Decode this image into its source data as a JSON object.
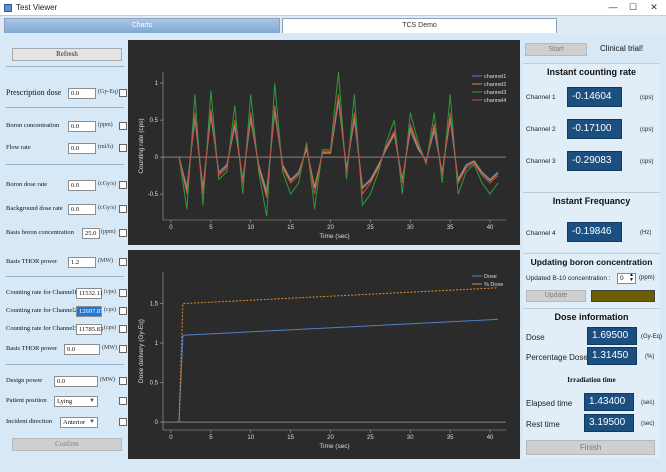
{
  "window": {
    "title": "Test Viewer",
    "minimize": "—",
    "maximize": "☐",
    "close": "✕"
  },
  "tabs": [
    {
      "label": "Charts"
    },
    {
      "label": "TCS Demo"
    }
  ],
  "left": {
    "refresh": "Refresh",
    "prescription": {
      "label": "Prescription dose",
      "value": "0.0",
      "unit": "(Gy-Eq)"
    },
    "boron_conc": {
      "label": "Boron concentration",
      "value": "0.0",
      "unit": "(ppm)"
    },
    "flow_rate": {
      "label": "Flow rate",
      "value": "0.0",
      "unit": "(ml/h)"
    },
    "boron_dose_rate": {
      "label": "Boron dose rate",
      "value": "0.0",
      "unit": "(cGy/s)"
    },
    "bg_dose_rate": {
      "label": "Background dose rate",
      "value": "0.0",
      "unit": "(cGy/s)"
    },
    "basis_boron_conc": {
      "label": "Basis boron concentration",
      "value": "25.0",
      "unit": "(ppm)"
    },
    "basis_thor_power1": {
      "label": "Basis THOR power",
      "value": "1.2",
      "unit": "(MW)"
    },
    "count_ch1": {
      "label": "Counting rate for Channel1",
      "value": "11532.11",
      "unit": "(cps)"
    },
    "count_ch2": {
      "label": "Counting rate for Channel2",
      "value": "12697.87",
      "unit": "(cps)"
    },
    "count_ch3": {
      "label": "Counting rate for Channel3",
      "value": "11785.83",
      "unit": "(cps)"
    },
    "basis_thor_power2": {
      "label": "Basis THOR power",
      "value": "0.0",
      "unit": "(MW)"
    },
    "design_power": {
      "label": "Design power",
      "value": "0.0",
      "unit": "(MW)"
    },
    "patient_position": {
      "label": "Patient position",
      "value": "Lying"
    },
    "incident_direction": {
      "label": "Incident direction",
      "value": "Anterior"
    },
    "confirm": "Confirm"
  },
  "chart_data": [
    {
      "type": "line",
      "ylabel": "Counting rate (cps)",
      "xlabel": "Time (sec)",
      "xlim": [
        -1,
        42
      ],
      "ylim": [
        -0.85,
        1.15
      ],
      "xticks": [
        0,
        5,
        10,
        15,
        20,
        25,
        30,
        35,
        40
      ],
      "yticks": [
        -0.5,
        0,
        0.5,
        1
      ],
      "grid": false,
      "legend": "top-right",
      "x": [
        1,
        2,
        3,
        4,
        5,
        6,
        7,
        8,
        9,
        10,
        11,
        12,
        13,
        14,
        15,
        16,
        17,
        18,
        19,
        20,
        21,
        22,
        23,
        24,
        25,
        26,
        27,
        28,
        29,
        30,
        31,
        32,
        33,
        34,
        35,
        36,
        37,
        38,
        39,
        40,
        41
      ],
      "series": [
        {
          "name": "channel1",
          "color": "#4f7fc4",
          "values": [
            0,
            -0.4,
            0.5,
            -0.4,
            0.55,
            -0.2,
            -0.1,
            0.4,
            -0.3,
            0.5,
            -0.1,
            -0.45,
            0.6,
            -0.1,
            -0.3,
            -0.2,
            0.1,
            -0.4,
            0.05,
            0.05,
            0.75,
            -0.15,
            0.5,
            -0.4,
            -0.3,
            -0.1,
            0.1,
            0.3,
            -0.3,
            0.35,
            0.1,
            -0.05,
            0.35,
            -0.2,
            0.5,
            -0.3,
            -0.1,
            -0.05,
            -0.2,
            -0.3,
            -0.2
          ]
        },
        {
          "name": "channel2",
          "color": "#e08a2c",
          "values": [
            0,
            -0.45,
            0.55,
            -0.45,
            0.6,
            -0.22,
            -0.12,
            0.45,
            -0.32,
            0.55,
            -0.12,
            -0.5,
            0.65,
            -0.12,
            -0.32,
            -0.22,
            0.12,
            -0.42,
            0.06,
            0.06,
            0.8,
            -0.18,
            0.55,
            -0.42,
            -0.32,
            -0.12,
            0.12,
            0.32,
            -0.32,
            0.4,
            0.12,
            -0.06,
            0.4,
            -0.22,
            0.55,
            -0.32,
            -0.12,
            -0.06,
            -0.22,
            -0.32,
            -0.22
          ]
        },
        {
          "name": "channel3",
          "color": "#2f9a3a",
          "values": [
            0,
            -0.7,
            0.85,
            -0.65,
            0.9,
            -0.3,
            -0.2,
            0.7,
            -0.5,
            0.85,
            -0.2,
            -0.8,
            1.0,
            -0.2,
            -0.5,
            -0.35,
            0.2,
            -0.7,
            0.1,
            0.1,
            1.15,
            -0.3,
            0.85,
            -0.65,
            -0.5,
            -0.2,
            0.2,
            0.5,
            -0.5,
            0.6,
            0.2,
            -0.1,
            0.6,
            -0.35,
            0.85,
            -0.5,
            -0.2,
            -0.1,
            -0.35,
            -0.5,
            -0.35
          ]
        },
        {
          "name": "channel4",
          "color": "#c0504d",
          "values": [
            0,
            -0.5,
            0.6,
            -0.5,
            0.65,
            -0.25,
            -0.15,
            0.5,
            -0.35,
            0.6,
            -0.15,
            -0.55,
            0.7,
            -0.15,
            -0.35,
            -0.25,
            0.15,
            -0.5,
            0.08,
            0.08,
            0.85,
            -0.2,
            0.6,
            -0.5,
            -0.35,
            -0.15,
            0.15,
            0.35,
            -0.35,
            0.45,
            0.15,
            -0.08,
            0.45,
            -0.25,
            0.6,
            -0.35,
            -0.15,
            -0.08,
            -0.25,
            -0.35,
            -0.25
          ]
        }
      ]
    },
    {
      "type": "line",
      "ylabel": "Dose delivery (Gy-Eq)",
      "xlabel": "Time (sec)",
      "xlim": [
        -1,
        42
      ],
      "ylim": [
        -0.1,
        1.9
      ],
      "xticks": [
        0,
        5,
        10,
        15,
        20,
        25,
        30,
        35,
        40
      ],
      "yticks": [
        0,
        0.5,
        1,
        1.5
      ],
      "grid": false,
      "legend": "top-right",
      "series": [
        {
          "name": "Dose",
          "color": "#4f7fc4",
          "x": [
            1,
            1.5,
            41
          ],
          "values": [
            0,
            1.1,
            1.3
          ]
        },
        {
          "name": "% Dose",
          "color": "#e08a2c",
          "x": [
            1,
            1.5,
            41
          ],
          "values": [
            0,
            1.5,
            1.7
          ]
        }
      ]
    }
  ],
  "right": {
    "start": "Start",
    "clinical_trial": "Clinical trial!",
    "instant_counting_rate": "Instant counting rate",
    "channel1": {
      "label": "Channel 1",
      "value": "-0.14604",
      "unit": "(cps)"
    },
    "channel2": {
      "label": "Channel 2",
      "value": "-0.17100",
      "unit": "(cps)"
    },
    "channel3": {
      "label": "Channel 3",
      "value": "-0.29083",
      "unit": "(cps)"
    },
    "instant_frequency": "Instant Frequancy",
    "channel4": {
      "label": "Channel 4",
      "value": "-0.19846",
      "unit": "(Hz)"
    },
    "updating_boron": "Updating boron concentration",
    "updated_b10": {
      "label": "Updated B-10 concentration :",
      "value": "0",
      "unit": "(ppm)"
    },
    "update": "Update",
    "dose_information": "Dose information",
    "dose": {
      "label": "Dose",
      "value": "1.69500",
      "unit": "(Gy-Eq)"
    },
    "pct_dose": {
      "label": "Percentage Dose",
      "value": "1.31450",
      "unit": "(%)"
    },
    "irradiation_time": "Irradiation time",
    "elapsed": {
      "label": "Elapsed time",
      "value": "1.43400",
      "unit": "(sec)"
    },
    "rest": {
      "label": "Rest time",
      "value": "3.19500",
      "unit": "(sec)"
    },
    "finish": "Finish",
    "status_color": "#6b5f00"
  }
}
